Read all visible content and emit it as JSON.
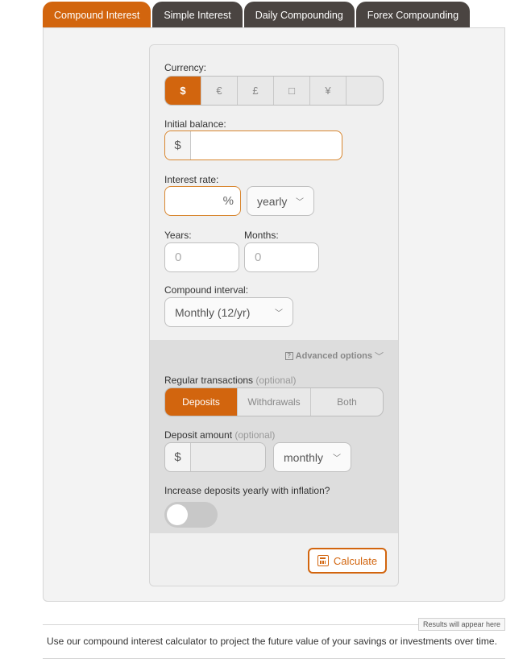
{
  "tabs": [
    {
      "label": "Compound Interest",
      "active": true
    },
    {
      "label": "Simple Interest",
      "active": false
    },
    {
      "label": "Daily Compounding",
      "active": false
    },
    {
      "label": "Forex Compounding",
      "active": false
    }
  ],
  "currency": {
    "label": "Currency:",
    "options": [
      "$",
      "€",
      "£",
      "□",
      "¥",
      ""
    ],
    "selected": "$"
  },
  "initial_balance": {
    "label": "Initial balance:",
    "prefix": "$",
    "value": ""
  },
  "interest_rate": {
    "label": "Interest rate:",
    "value": "",
    "suffix": "%",
    "period": "yearly"
  },
  "duration": {
    "years_label": "Years:",
    "years_placeholder": "0",
    "months_label": "Months:",
    "months_placeholder": "0"
  },
  "compound_interval": {
    "label": "Compound interval:",
    "value": "Monthly (12/yr)"
  },
  "advanced_options_label": "Advanced options",
  "regular_transactions": {
    "label": "Regular transactions",
    "optional": "(optional)",
    "options": [
      "Deposits",
      "Withdrawals",
      "Both"
    ],
    "selected": "Deposits"
  },
  "deposit_amount": {
    "label": "Deposit amount",
    "optional": "(optional)",
    "prefix": "$",
    "value": "",
    "period": "monthly"
  },
  "inflation": {
    "label": "Increase deposits yearly with inflation?",
    "enabled": false
  },
  "calculate_label": "Calculate",
  "results_tag": "Results will appear here",
  "description": "Use our compound interest calculator to project the future value of your savings or investments over time.",
  "colors": {
    "accent": "#d2650e",
    "tab_dark": "#4a4441",
    "panel": "#f0f0f0",
    "advanced_panel": "#dddddd"
  }
}
